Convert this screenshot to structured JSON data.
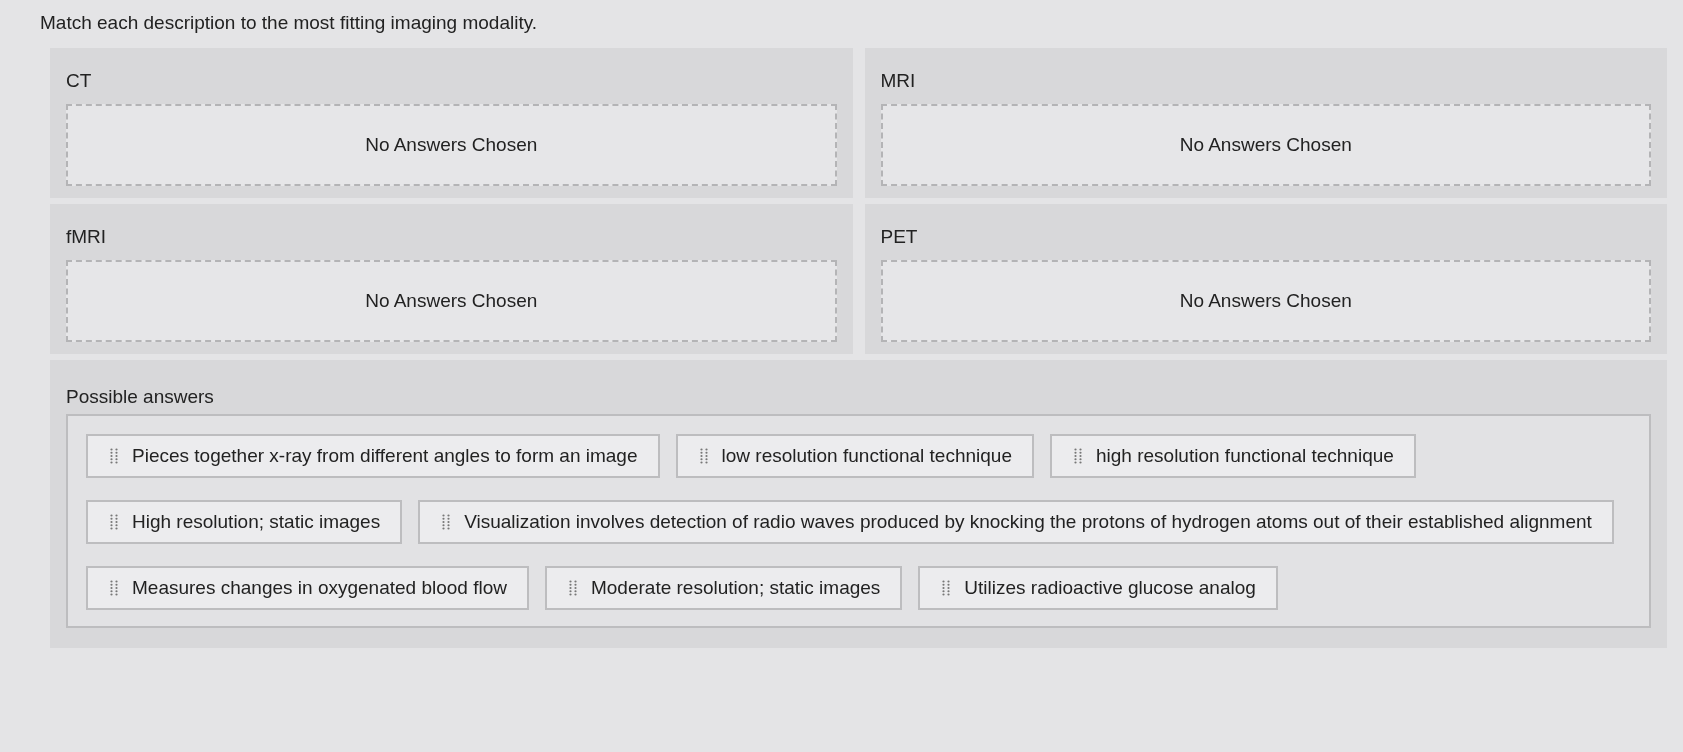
{
  "title": "Match each description to the most fitting imaging modality.",
  "groups": [
    {
      "label": "CT",
      "empty_text": "No Answers Chosen"
    },
    {
      "label": "MRI",
      "empty_text": "No Answers Chosen"
    },
    {
      "label": "fMRI",
      "empty_text": "No Answers Chosen"
    },
    {
      "label": "PET",
      "empty_text": "No Answers Chosen"
    }
  ],
  "answers_panel": {
    "title": "Possible answers",
    "answers": [
      "Pieces together x-ray from different angles to form an image",
      "low resolution functional technique",
      "high resolution functional technique",
      "High resolution; static images",
      "Visualization involves detection of radio waves produced by knocking the protons of hydrogen atoms out of their established alignment",
      "Measures changes in oxygenated blood flow",
      "Moderate resolution; static images",
      "Utilizes radioactive glucose analog"
    ]
  }
}
